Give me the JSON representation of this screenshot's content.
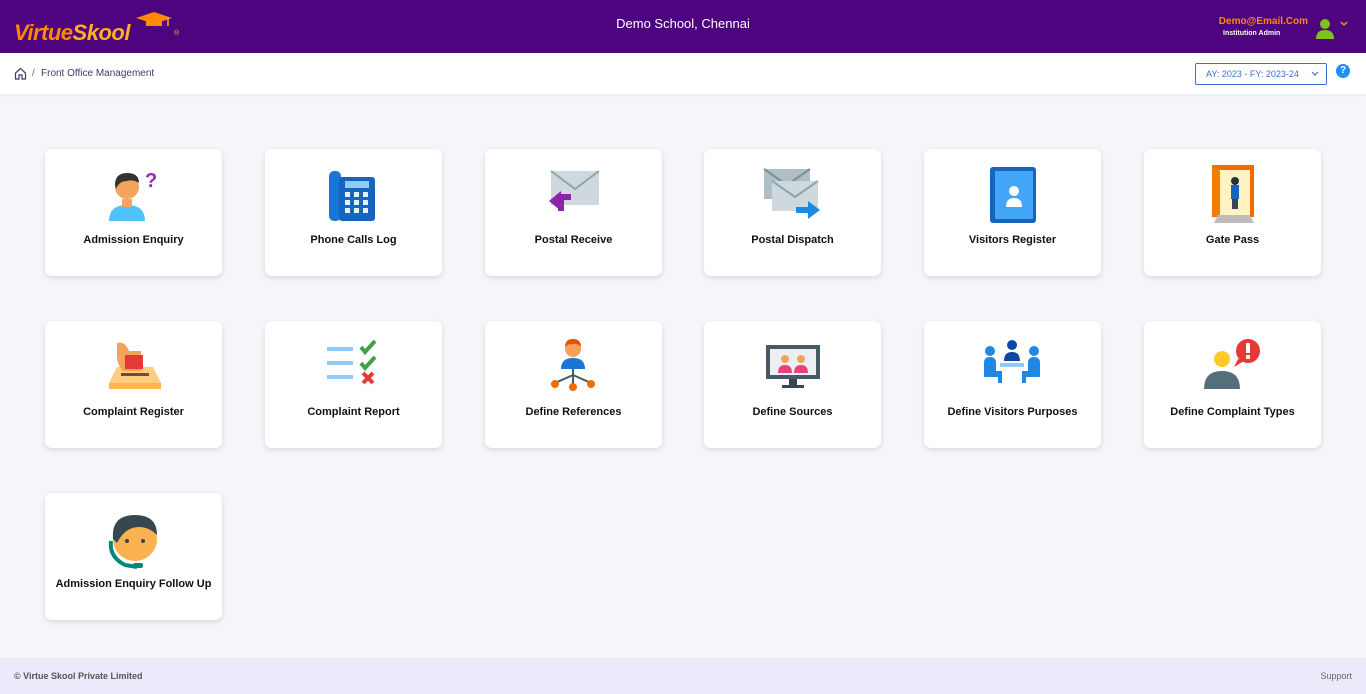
{
  "header": {
    "logo_text_virtue": "Virtue",
    "logo_text_skool": "Skool",
    "logo_reg": "®",
    "school_name": "Demo School, Chennai",
    "user_email": "Demo@Email.Com",
    "user_role": "Institution Admin",
    "colors": {
      "bar": "#4d047e",
      "accent": "#ff8a00"
    }
  },
  "breadcrumb": {
    "separator": "/",
    "current": "Front Office Management"
  },
  "year_select": {
    "value": "AY: 2023 - FY: 2023-24"
  },
  "help_label": "?",
  "modules": [
    {
      "label": "Admission Enquiry",
      "icon": "admission-enquiry-icon"
    },
    {
      "label": "Phone Calls Log",
      "icon": "phone-icon"
    },
    {
      "label": "Postal Receive",
      "icon": "mail-receive-icon"
    },
    {
      "label": "Postal Dispatch",
      "icon": "mail-dispatch-icon"
    },
    {
      "label": "Visitors Register",
      "icon": "contact-book-icon"
    },
    {
      "label": "Gate Pass",
      "icon": "door-icon"
    },
    {
      "label": "Complaint Register",
      "icon": "ballot-box-icon"
    },
    {
      "label": "Complaint Report",
      "icon": "checklist-icon"
    },
    {
      "label": "Define References",
      "icon": "person-network-icon"
    },
    {
      "label": "Define Sources",
      "icon": "monitor-users-icon"
    },
    {
      "label": "Define Visitors Purposes",
      "icon": "meeting-icon"
    },
    {
      "label": "Define Complaint Types",
      "icon": "user-alert-icon"
    },
    {
      "label": "Admission Enquiry Follow Up",
      "icon": "headset-agent-icon"
    }
  ],
  "footer": {
    "copyright": "© Virtue Skool Private Limited",
    "support": "Support"
  }
}
